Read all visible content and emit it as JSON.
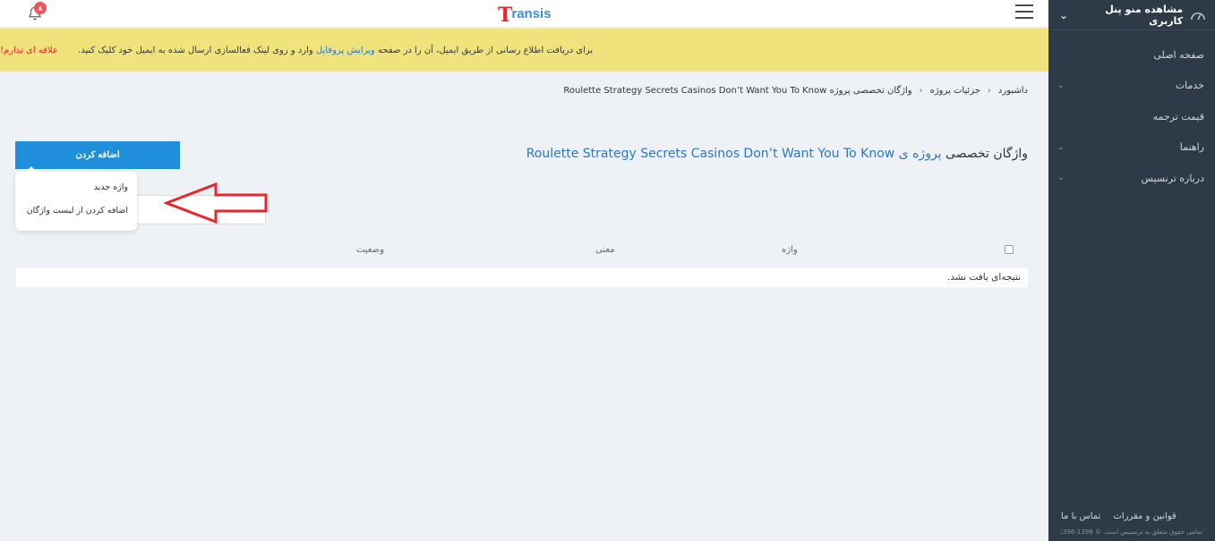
{
  "sidebar": {
    "header_title": "مشاهده منو پنل کاربری",
    "items": [
      {
        "label": "صفحه اصلی",
        "has_submenu": false
      },
      {
        "label": "خدمات",
        "has_submenu": true
      },
      {
        "label": "قیمت ترجمه",
        "has_submenu": false
      },
      {
        "label": "راهنما",
        "has_submenu": true
      },
      {
        "label": "درباره ترنسیس",
        "has_submenu": true
      }
    ],
    "footer_links": [
      "قوانین و مقررات",
      "تماس با ما"
    ],
    "copyright": "تمامی حقوق متعلق به ترنسیس است. © 1398-1396"
  },
  "topbar": {
    "notification_count": "۸",
    "logo_initial": "T",
    "logo_rest": "ransis"
  },
  "alert": {
    "text_before": "برای دریافت اطلاع رسانی از طریق ایمیل، آن را در صفحه ",
    "link_text": "ویرایش پروفایل",
    "text_after": " وارد و روی لینک فعالسازی ارسال شده به ایمیل خود کلیک کنید.",
    "dismiss_text": "علاقه ای ندارم!"
  },
  "breadcrumb": [
    "داشبورد",
    "جزئیات پروژه",
    "واژگان تخصصی پروژه Roulette Strategy Secrets Casinos Don’t Want You To Know"
  ],
  "page": {
    "title_prefix": "واژگان تخصصی ",
    "title_project_word": "پروژه ی",
    "title_project_name": "Roulette Strategy Secrets Casinos Don’t Want You To Know",
    "add_button": "اضافه کردن",
    "dropdown_items": [
      "واژه جدید",
      "اضافه کردن از لیست واژگان"
    ]
  },
  "table": {
    "headers": [
      "واژه",
      "معنی",
      "وضعیت"
    ],
    "empty_message": "نتیجه‌ای یافت نشد."
  },
  "colors": {
    "sidebar_bg": "#2e3a47",
    "alert_bg": "#f0e37c",
    "primary": "#1f8fdb",
    "link": "#2a78c6",
    "danger": "#e8262e",
    "arrow": "#e8262e"
  }
}
